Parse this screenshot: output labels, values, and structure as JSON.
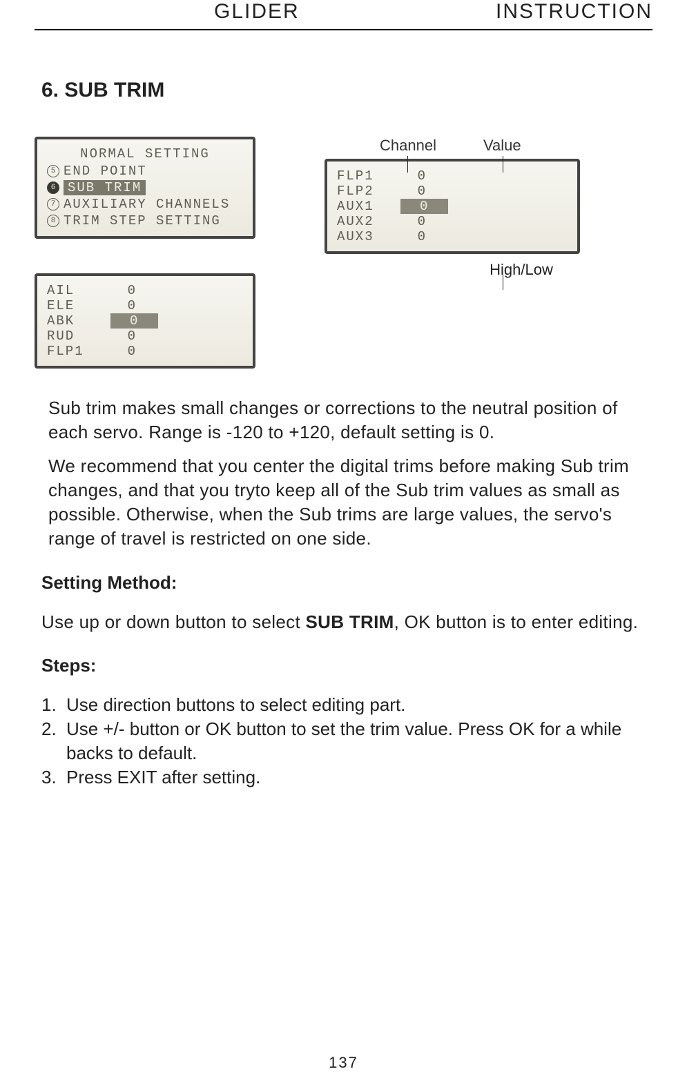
{
  "header": {
    "left": "GLIDER",
    "right": "INSTRUCTION"
  },
  "section_title": "6. SUB TRIM",
  "lcd_menu": {
    "title": "NORMAL SETTING",
    "items": [
      {
        "num": "5",
        "label": "END POINT",
        "selected": false
      },
      {
        "num": "6",
        "label": "SUB TRIM",
        "selected": true
      },
      {
        "num": "7",
        "label": "AUXILIARY CHANNELS",
        "selected": false
      },
      {
        "num": "8",
        "label": "TRIM STEP SETTING",
        "selected": false
      }
    ]
  },
  "lcd_values_a": [
    {
      "k": "AIL",
      "v": "0",
      "selected": false
    },
    {
      "k": "ELE",
      "v": "0",
      "selected": false
    },
    {
      "k": "ABK",
      "v": "0",
      "selected": true
    },
    {
      "k": "RUD",
      "v": "0",
      "selected": false
    },
    {
      "k": "FLP1",
      "v": "0",
      "selected": false
    }
  ],
  "lcd_values_b": [
    {
      "k": "FLP1",
      "v": "0",
      "selected": false
    },
    {
      "k": "FLP2",
      "v": "0",
      "selected": false
    },
    {
      "k": "AUX1",
      "v": "0",
      "selected": true
    },
    {
      "k": "AUX2",
      "v": "0",
      "selected": false
    },
    {
      "k": "AUX3",
      "v": "0",
      "selected": false
    }
  ],
  "annot": {
    "channel": "Channel",
    "value": "Value",
    "highlow": "High/Low"
  },
  "para1": "Sub trim makes small changes or corrections to the neutral position of each servo. Range is -120 to +120, default setting is 0.",
  "para2": "We recommend that you center the digital trims before making Sub trim changes, and that you tryto keep all of the Sub trim values as small as possible. Otherwise, when the Sub trims are large values, the servo's range of travel is restricted on one side.",
  "setting_method_h": "Setting Method:",
  "setting_method_p_pre": "Use up or down button to select ",
  "setting_method_p_bold": "SUB TRIM",
  "setting_method_p_post": ", OK button is to enter editing.",
  "steps_h": "Steps:",
  "steps": [
    "Use direction buttons to select editing part.",
    "Use +/- button or OK button to set the trim value. Press OK for a while backs to default.",
    "Press EXIT after setting."
  ],
  "page_number": "137"
}
